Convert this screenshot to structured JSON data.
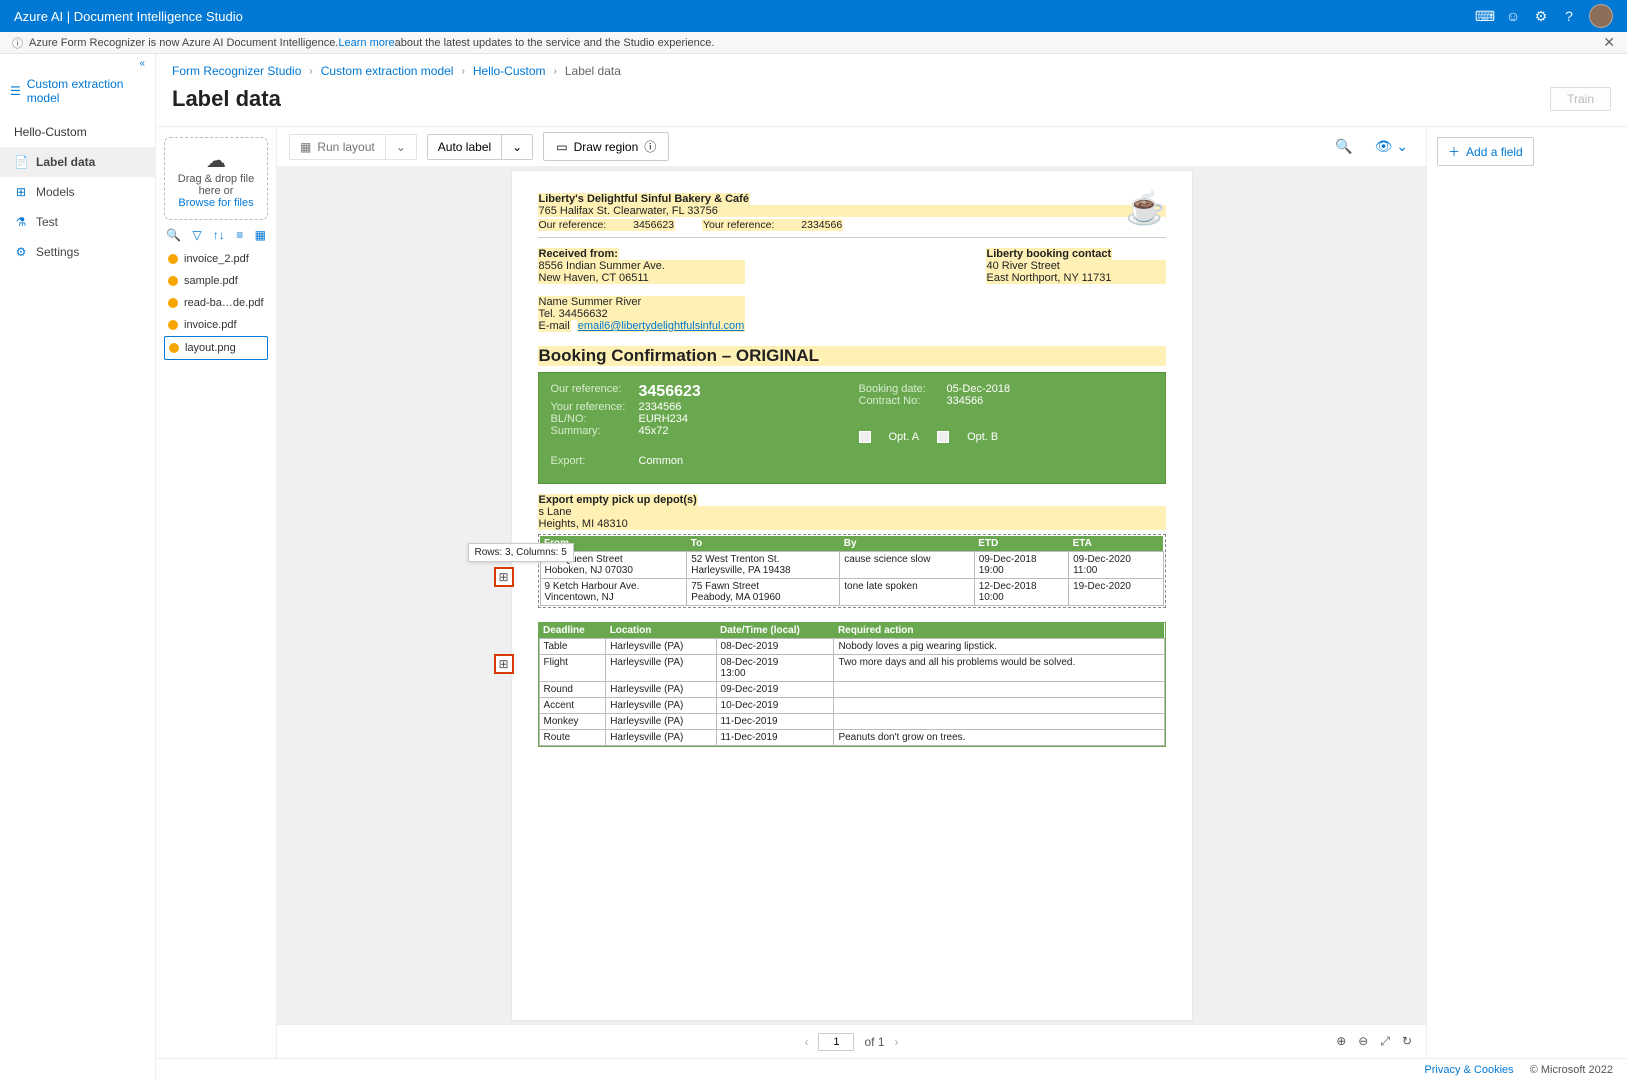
{
  "topbar": {
    "title": "Azure AI | Document Intelligence Studio"
  },
  "banner": {
    "prefix": "Azure Form Recognizer is now Azure AI Document Intelligence. ",
    "link": "Learn more",
    "suffix": " about the latest updates to the service and the Studio experience."
  },
  "sidebar": {
    "model_type": "Custom extraction model",
    "project": "Hello-Custom",
    "items": [
      {
        "icon": "📄",
        "label": "Label data",
        "active": true
      },
      {
        "icon": "⊞",
        "label": "Models"
      },
      {
        "icon": "⚗",
        "label": "Test"
      },
      {
        "icon": "⚙",
        "label": "Settings"
      }
    ]
  },
  "breadcrumb": {
    "items": [
      "Form Recognizer Studio",
      "Custom extraction model",
      "Hello-Custom",
      "Label data"
    ]
  },
  "page_title": "Label data",
  "train_label": "Train",
  "filepanel": {
    "drop_line1": "Drag & drop file",
    "drop_line2": "here or",
    "browse": "Browse for files",
    "files": [
      "invoice_2.pdf",
      "sample.pdf",
      "read-ba…de.pdf",
      "invoice.pdf",
      "layout.png"
    ],
    "selected_index": 4
  },
  "doc_toolbar": {
    "run_layout": "Run layout",
    "auto_label": "Auto label",
    "draw_region": "Draw region"
  },
  "doc": {
    "company": "Liberty's Delightful Sinful Bakery & Café",
    "address": "765 Halifax St. Clearwater, FL 33756",
    "our_ref_lbl": "Our reference:",
    "our_ref": "3456623",
    "your_ref_lbl": "Your reference:",
    "your_ref": "2334566",
    "received_from_hdr": "Received from:",
    "received_lines": [
      "8556 Indian Summer Ave.",
      "New Haven, CT 06511"
    ],
    "contact_hdr": "Liberty booking contact",
    "contact_lines": [
      "40 River Street",
      "East Northport, NY 11731"
    ],
    "name_line": "Name Summer River",
    "tel_line": "Tel. 34456632",
    "email_lbl": "E-mail",
    "email": "email6@libertydelightfulsinful.com",
    "section_title": "Booking Confirmation – ORIGINAL",
    "green": {
      "our_ref_lbl": "Our reference:",
      "our_ref": "3456623",
      "your_ref_lbl": "Your reference:",
      "your_ref": "2334566",
      "blno_lbl": "BL/NO:",
      "blno": "EURH234",
      "summary_lbl": "Summary:",
      "summary": "45x72",
      "export_lbl": "Export:",
      "export": "Common",
      "booking_date_lbl": "Booking date:",
      "booking_date": "05-Dec-2018",
      "contract_lbl": "Contract No:",
      "contract": "334566",
      "opt_a": "Opt. A",
      "opt_b": "Opt. B"
    },
    "depot_hdr": "Export empty pick up depot(s)",
    "depot_lines": [
      "s Lane",
      "Heights, MI 48310"
    ],
    "tooltip": "Rows: 3, Columns: 5",
    "table1": {
      "headers": [
        "From",
        "To",
        "By",
        "ETD",
        "ETA"
      ],
      "rows": [
        [
          "118 Queen Street\nHoboken, NJ 07030",
          "52 West Trenton St.\nHarleysville, PA 19438",
          "cause science slow",
          "09-Dec-2018\n19:00",
          "09-Dec-2020\n11:00"
        ],
        [
          "9 Ketch Harbour Ave.\nVincentown, NJ",
          "75 Fawn Street\nPeabody, MA 01960",
          "tone late spoken",
          "12-Dec-2018\n10:00",
          "19-Dec-2020"
        ]
      ]
    },
    "table2": {
      "headers": [
        "Deadline",
        "Location",
        "Date/Time (local)",
        "Required action"
      ],
      "rows": [
        [
          "Table",
          "Harleysville (PA)",
          "08-Dec-2019",
          "Nobody loves a pig wearing lipstick."
        ],
        [
          "Flight",
          "Harleysville (PA)",
          "08-Dec-2019\n13:00",
          "Two more days and all his problems would be solved."
        ],
        [
          "Round",
          "Harleysville (PA)",
          "09-Dec-2019",
          ""
        ],
        [
          "Accent",
          "Harleysville (PA)",
          "10-Dec-2019",
          ""
        ],
        [
          "Monkey",
          "Harleysville (PA)",
          "11-Dec-2019",
          ""
        ],
        [
          "Route",
          "Harleysville (PA)",
          "11-Dec-2019",
          "Peanuts don't grow on trees."
        ]
      ]
    }
  },
  "pager": {
    "page": "1",
    "of": "of 1"
  },
  "fieldpanel": {
    "add_field": "Add a field"
  },
  "footer": {
    "privacy": "Privacy & Cookies",
    "copyright": "© Microsoft 2022"
  }
}
